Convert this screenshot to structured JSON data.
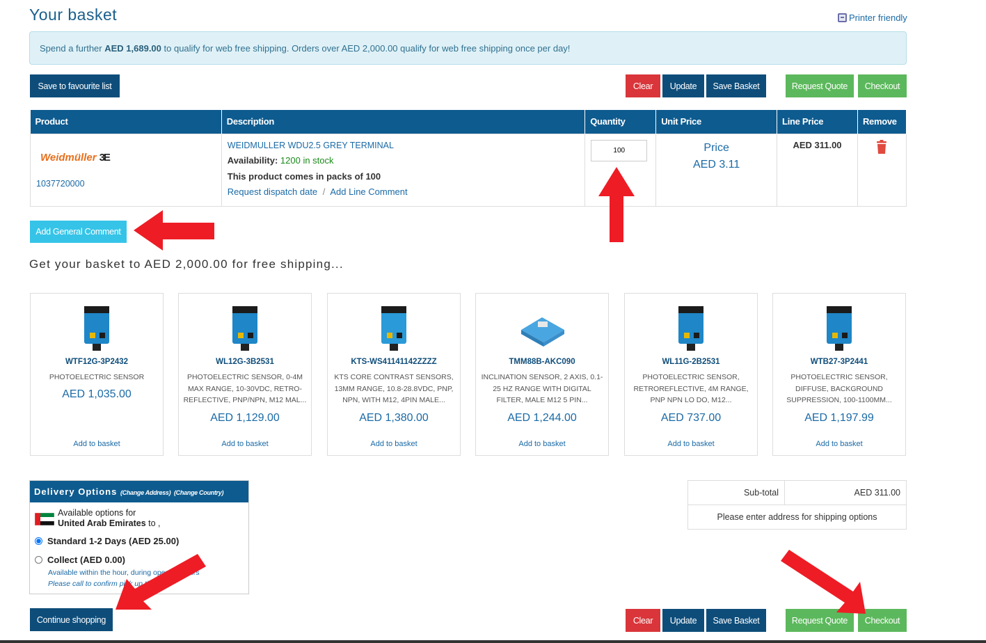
{
  "page": {
    "title": "Your basket",
    "printer_link": "Printer friendly"
  },
  "notice": {
    "prefix": "Spend a further ",
    "amount": "AED 1,689.00",
    "suffix": " to qualify for web free shipping. Orders over AED 2,000.00 qualify for web free shipping once per day!"
  },
  "toolbar": {
    "save_favourite": "Save to favourite list",
    "clear": "Clear",
    "update": "Update",
    "save_basket": "Save Basket",
    "request_quote": "Request Quote",
    "checkout": "Checkout"
  },
  "basket": {
    "headers": [
      "Product",
      "Description",
      "Quantity",
      "Unit Price",
      "Line Price",
      "Remove"
    ],
    "item": {
      "brand": "Weidmüller",
      "brand_mark": "3E",
      "product_code": "1037720000",
      "name": "WEIDMULLER WDU2.5 GREY TERMINAL",
      "availability_label": "Availability:",
      "availability_value": "1200 in stock",
      "pack_note": "This product comes in packs of 100",
      "request_dispatch": "Request dispatch date",
      "separator": "/",
      "add_line_comment": "Add Line Comment",
      "quantity": "100",
      "unit_price_label": "Price",
      "unit_price": "AED 3.11",
      "line_price": "AED 311.00",
      "remove_icon": "trash-icon"
    }
  },
  "general_comment": "Add General Comment",
  "upsell": {
    "title": "Get your basket to AED 2,000.00 for free shipping...",
    "add_label": "Add to basket",
    "products": [
      {
        "code": "WTF12G-3P2432",
        "desc": "PHOTOELECTRIC SENSOR",
        "price": "AED 1,035.00",
        "color": "#1f86c7"
      },
      {
        "code": "WL12G-3B2531",
        "desc": "PHOTOELECTRIC SENSOR, 0-4M MAX RANGE, 10-30VDC, RETRO-REFLECTIVE, PNP/NPN, M12 MAL...",
        "price": "AED 1,129.00",
        "color": "#1f86c7"
      },
      {
        "code": "KTS-WS41141142ZZZZ",
        "desc": "KTS CORE CONTRAST SENSORS, 13MM RANGE, 10.8-28.8VDC, PNP, NPN, WITH M12, 4PIN MALE...",
        "price": "AED 1,380.00",
        "color": "#2a9ad8"
      },
      {
        "code": "TMM88B-AKC090",
        "desc": "INCLINATION SENSOR, 2 AXIS, 0.1-25 HZ RANGE WITH DIGITAL FILTER, MALE M12 5 PIN...",
        "price": "AED 1,244.00",
        "color": "#4aa6e0"
      },
      {
        "code": "WL11G-2B2531",
        "desc": "PHOTOELECTRIC SENSOR, RETROREFLECTIVE, 4M RANGE, PNP NPN LO DO, M12...",
        "price": "AED 737.00",
        "color": "#1f86c7"
      },
      {
        "code": "WTB27-3P2441",
        "desc": "PHOTOELECTRIC SENSOR, DIFFUSE, BACKGROUND SUPPRESSION, 100-1100MM...",
        "price": "AED 1,197.99",
        "color": "#1f86c7"
      }
    ]
  },
  "delivery": {
    "title": "Delivery Options",
    "change_address": "(Change Address)",
    "change_country": "(Change Country)",
    "available_for": "Available options for",
    "country": "United Arab Emirates",
    "to_text": " to ,",
    "options": [
      {
        "label": "Standard 1-2 Days (AED 25.00)",
        "selected": true
      },
      {
        "label": "Collect (AED 0.00)",
        "selected": false
      }
    ],
    "collect_note1": "Available within the hour, during opening hours",
    "collect_note2": "Please call to confirm pick up time"
  },
  "summary": {
    "subtotal_label": "Sub-total",
    "subtotal_value": "AED 311.00",
    "shipping_note": "Please enter address for shipping options"
  },
  "footer": {
    "continue_shopping": "Continue shopping"
  },
  "colors": {
    "navy": "#0e4d7a",
    "red": "#d9353a",
    "green": "#5cb85c",
    "cyan": "#35c4e8",
    "arrow": "#ee1c25"
  }
}
